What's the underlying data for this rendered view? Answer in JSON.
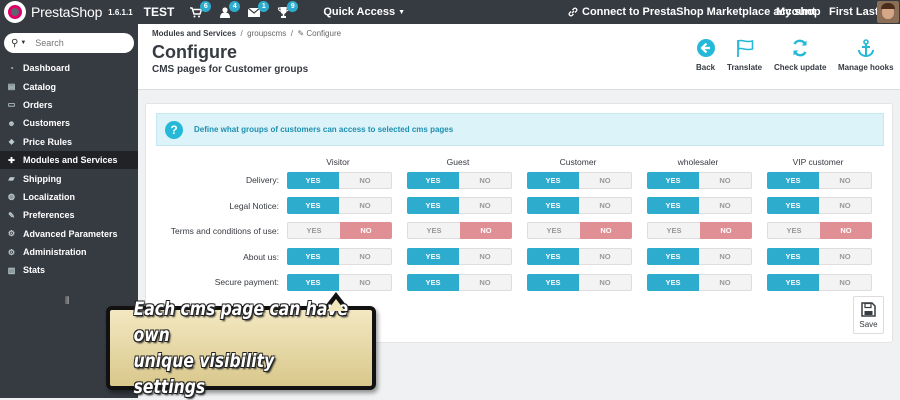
{
  "topbar": {
    "brand": "PrestaShop",
    "version": "1.6.1.1",
    "shop_name": "TEST",
    "notifications": [
      {
        "icon": "cart-icon",
        "count": "6"
      },
      {
        "icon": "user-icon",
        "count": "4"
      },
      {
        "icon": "envelope-icon",
        "count": "1"
      },
      {
        "icon": "trophy-icon",
        "count": "9"
      }
    ],
    "quick_access": "Quick Access",
    "marketplace": "Connect to PrestaShop Marketplace account",
    "my_shop": "My shop",
    "user": "First Last"
  },
  "sidebar": {
    "search_placeholder": "Search",
    "items": [
      {
        "label": "Dashboard",
        "icon": "dashboard-icon"
      },
      {
        "label": "Catalog",
        "icon": "catalog-icon"
      },
      {
        "label": "Orders",
        "icon": "orders-icon"
      },
      {
        "label": "Customers",
        "icon": "customers-icon"
      },
      {
        "label": "Price Rules",
        "icon": "price-rules-icon"
      },
      {
        "label": "Modules and Services",
        "icon": "modules-icon"
      },
      {
        "label": "Shipping",
        "icon": "shipping-icon"
      },
      {
        "label": "Localization",
        "icon": "localization-icon"
      },
      {
        "label": "Preferences",
        "icon": "preferences-icon"
      },
      {
        "label": "Advanced Parameters",
        "icon": "advanced-icon"
      },
      {
        "label": "Administration",
        "icon": "administration-icon"
      },
      {
        "label": "Stats",
        "icon": "stats-icon"
      }
    ],
    "active": "Modules and Services"
  },
  "header": {
    "breadcrumb": {
      "root": "Modules and Services",
      "sep": "/",
      "module": "groupscms",
      "current": "Configure"
    },
    "title": "Configure",
    "subtitle": "CMS pages for Customer groups",
    "tools": [
      {
        "label": "Back",
        "icon": "back-icon"
      },
      {
        "label": "Translate",
        "icon": "flag-icon"
      },
      {
        "label": "Check update",
        "icon": "refresh-icon"
      },
      {
        "label": "Manage hooks",
        "icon": "anchor-icon"
      }
    ]
  },
  "panel": {
    "info": "Define what groups of customers can access to selected cms pages",
    "yes_label": "YES",
    "no_label": "NO",
    "groups": [
      "Visitor",
      "Guest",
      "Customer",
      "wholesaler",
      "VIP customer"
    ],
    "rows": [
      {
        "label": "Delivery:",
        "values": [
          true,
          true,
          true,
          true,
          true
        ]
      },
      {
        "label": "Legal Notice:",
        "values": [
          true,
          true,
          true,
          true,
          true
        ]
      },
      {
        "label": "Terms and conditions of use:",
        "values": [
          false,
          false,
          false,
          false,
          false
        ]
      },
      {
        "label": "About us:",
        "values": [
          true,
          true,
          true,
          true,
          true
        ]
      },
      {
        "label": "Secure payment:",
        "values": [
          true,
          true,
          true,
          true,
          true
        ]
      }
    ],
    "save_label": "Save"
  },
  "callout": {
    "line1": "Each cms page can have own",
    "line2": "unique visibility settings"
  },
  "colors": {
    "accent": "#2eacce",
    "danger": "#e08f95",
    "dark": "#363a41"
  }
}
